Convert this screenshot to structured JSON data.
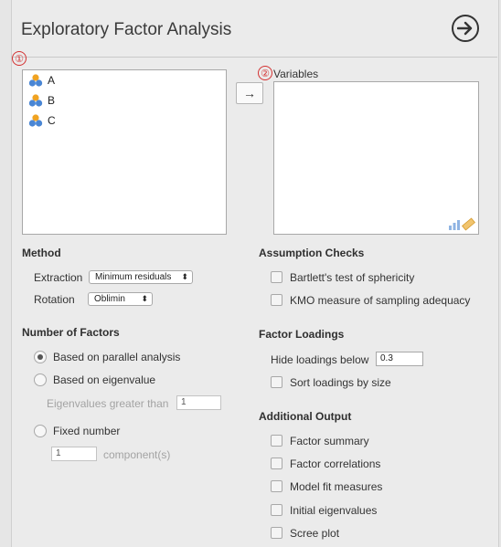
{
  "header": {
    "title": "Exploratory Factor Analysis"
  },
  "markers": [
    "①",
    "②"
  ],
  "available_variables": [
    {
      "name": "A",
      "icon": "nominal-variable-icon"
    },
    {
      "name": "B",
      "icon": "nominal-variable-icon"
    },
    {
      "name": "C",
      "icon": "nominal-variable-icon"
    }
  ],
  "move_button": {
    "label": "→"
  },
  "variables_box": {
    "label": "Variables"
  },
  "method": {
    "title": "Method",
    "extraction_label": "Extraction",
    "extraction_value": "Minimum residuals",
    "rotation_label": "Rotation",
    "rotation_value": "Oblimin"
  },
  "number_of_factors": {
    "title": "Number of Factors",
    "parallel": "Based on parallel analysis",
    "eigenvalue": "Based on eigenvalue",
    "eigen_greater_label": "Eigenvalues greater than",
    "eigen_greater_value": "1",
    "fixed": "Fixed number",
    "fixed_value": "1",
    "component_label": "component(s)",
    "selected": "parallel"
  },
  "assumption_checks": {
    "title": "Assumption Checks",
    "bartlett": "Bartlett's test of sphericity",
    "kmo": "KMO measure of sampling adequacy"
  },
  "factor_loadings": {
    "title": "Factor Loadings",
    "hide_label": "Hide loadings below",
    "hide_value": "0.3",
    "sort": "Sort loadings by size"
  },
  "additional_output": {
    "title": "Additional Output",
    "items": [
      "Factor summary",
      "Factor correlations",
      "Model fit measures",
      "Initial eigenvalues",
      "Scree plot"
    ]
  }
}
